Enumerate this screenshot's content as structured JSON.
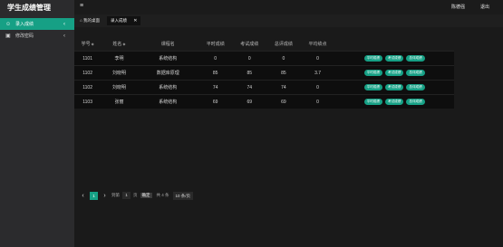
{
  "app_title": "学生成绩管理",
  "sidebar": {
    "items": [
      {
        "label": "录入成绩",
        "icon": "user-icon"
      },
      {
        "label": "修改密码",
        "icon": "lock-icon"
      }
    ]
  },
  "topbar": {
    "menu_icon": "≡",
    "user_label": "陈德强",
    "logout_label": "退出"
  },
  "tabs": [
    {
      "label": "我的桌面",
      "icon": "home-icon"
    },
    {
      "label": "录入成绩"
    }
  ],
  "table": {
    "headers": [
      "学号",
      "姓名",
      "课程名",
      "平时成绩",
      "考试成绩",
      "总评成绩",
      "平均绩点",
      ""
    ],
    "rows": [
      [
        "1101",
        "李明",
        "系统结构",
        "0",
        "0",
        "0",
        "0"
      ],
      [
        "1102",
        "刘晓明",
        "数据库原理",
        "85",
        "85",
        "85",
        "3.7"
      ],
      [
        "1102",
        "刘晓明",
        "系统结构",
        "74",
        "74",
        "74",
        "0"
      ],
      [
        "1103",
        "张丽",
        "系统结构",
        "69",
        "69",
        "69",
        "0"
      ]
    ],
    "actions": [
      "平时成绩",
      "考试成绩",
      "总评成绩"
    ]
  },
  "pager": {
    "current_page": "1",
    "goto_label": "到第",
    "goto_value": "1",
    "page_unit": "页",
    "confirm_label": "确定",
    "total_label": "共 4 条",
    "page_size_label": "10 条/页"
  }
}
